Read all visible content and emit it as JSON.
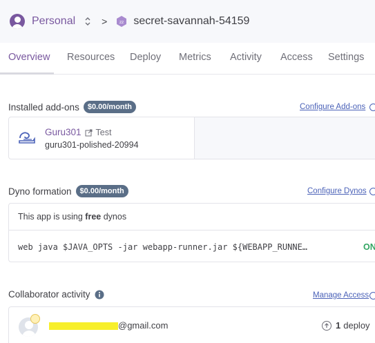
{
  "breadcrumb": {
    "team": "Personal",
    "separator": ">",
    "app_name": "secret-savannah-54159"
  },
  "tabs": [
    {
      "label": "Overview",
      "active": true
    },
    {
      "label": "Resources"
    },
    {
      "label": "Deploy"
    },
    {
      "label": "Metrics"
    },
    {
      "label": "Activity"
    },
    {
      "label": "Access"
    },
    {
      "label": "Settings"
    }
  ],
  "addons": {
    "title": "Installed add-ons",
    "cost": "$0.00/month",
    "configure_label": "Configure Add-ons",
    "items": [
      {
        "name": "Guru301",
        "plan": "Test",
        "id": "guru301-polished-20994"
      }
    ]
  },
  "dynos": {
    "title": "Dyno formation",
    "cost": "$0.00/month",
    "configure_label": "Configure Dynos",
    "info_prefix": "This app is using",
    "info_strong": "free",
    "info_suffix": "dynos",
    "command": "web  java $JAVA_OPTS -jar webapp-runner.jar ${WEBAPP_RUNNE…",
    "status": "ON"
  },
  "collaborators": {
    "title": "Collaborator activity",
    "manage_label": "Manage Access",
    "items": [
      {
        "email_domain": "@gmail.com",
        "deploy_count": "1",
        "deploy_label": "deploy"
      }
    ]
  },
  "colors": {
    "accent": "#79589f",
    "link": "#4b62b8",
    "status_on": "#31a562",
    "pill": "#5a6e87",
    "redaction": "#f7ef2b"
  },
  "icons": [
    "user-avatar-icon",
    "switch-icon",
    "app-icon",
    "external-link-icon",
    "guru301-icon",
    "info-icon",
    "arrow-right-circle-icon",
    "collaborator-avatar-icon",
    "crown-icon",
    "deploy-icon"
  ]
}
